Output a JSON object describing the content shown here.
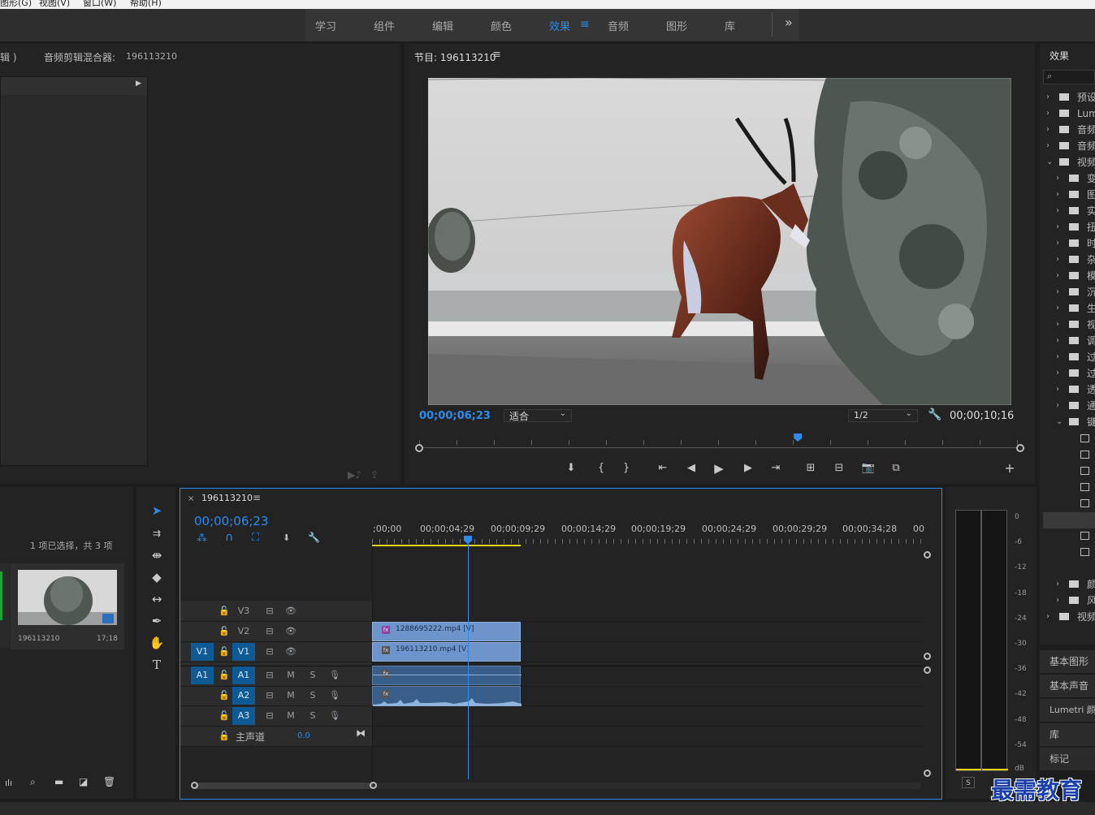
{
  "menu": {
    "items": [
      "图形(G)",
      "视图(V)",
      "窗口(W)",
      "帮助(H)"
    ]
  },
  "workspaces": {
    "tabs": [
      "学习",
      "组件",
      "编辑",
      "颜色",
      "效果",
      "音频",
      "图形",
      "库"
    ],
    "active": "效果",
    "overflow": "»"
  },
  "source_panel": {
    "left_label": "辑 )",
    "title": "音频剪辑混合器:",
    "sequence": "196113210"
  },
  "program": {
    "title": "节目: 196113210",
    "timecode": "00;00;06;23",
    "fit": "适合",
    "resolution": "1/2",
    "duration": "00;00;10;16",
    "playhead_fraction": 0.63
  },
  "project": {
    "selection": "1 项已选择，共 3 项",
    "item": {
      "name": "196113210",
      "duration": "17;18"
    }
  },
  "timeline": {
    "title": "196113210",
    "timecode": "00;00;06;23",
    "ruler": [
      ";00;00",
      "00;00;04;29",
      "00;00;09;29",
      "00;00;14;29",
      "00;00;19;29",
      "00;00;24;29",
      "00;00;29;29",
      "00;00;34;28",
      "00"
    ],
    "video_tracks": [
      "V3",
      "V2",
      "V1"
    ],
    "audio_tracks": [
      "A1",
      "A2",
      "A3"
    ],
    "source_v": "V1",
    "source_a": "A1",
    "master": {
      "label": "主声道",
      "value": "0.0"
    },
    "clips": {
      "v2": "1288695222.mp4 [V]",
      "v1": "196113210.mp4 [V]"
    }
  },
  "meter": {
    "db_labels": [
      "0",
      "-6",
      "-12",
      "-18",
      "-24",
      "-30",
      "-36",
      "-42",
      "-48",
      "-54",
      "dB"
    ],
    "solo": "S"
  },
  "effects": {
    "title": "效果",
    "tree": [
      "预设",
      "Lumetri",
      "音频",
      "音频",
      "视频",
      "变",
      "图",
      "实",
      "扭",
      "时",
      "杂",
      "模",
      "沉",
      "生",
      "视",
      "调",
      "过",
      "过",
      "透",
      "通",
      "键"
    ],
    "after": [
      "颜",
      "风",
      "视频"
    ],
    "side": [
      "基本图形",
      "基本声音",
      "Lumetri 颜",
      "库",
      "标记"
    ]
  },
  "watermark": "最需教育",
  "colors": {
    "accent": "#2d8ceb",
    "target": "#0e5a94",
    "clip": "#6d95cc",
    "audio_clip": "#3a5e8a"
  }
}
